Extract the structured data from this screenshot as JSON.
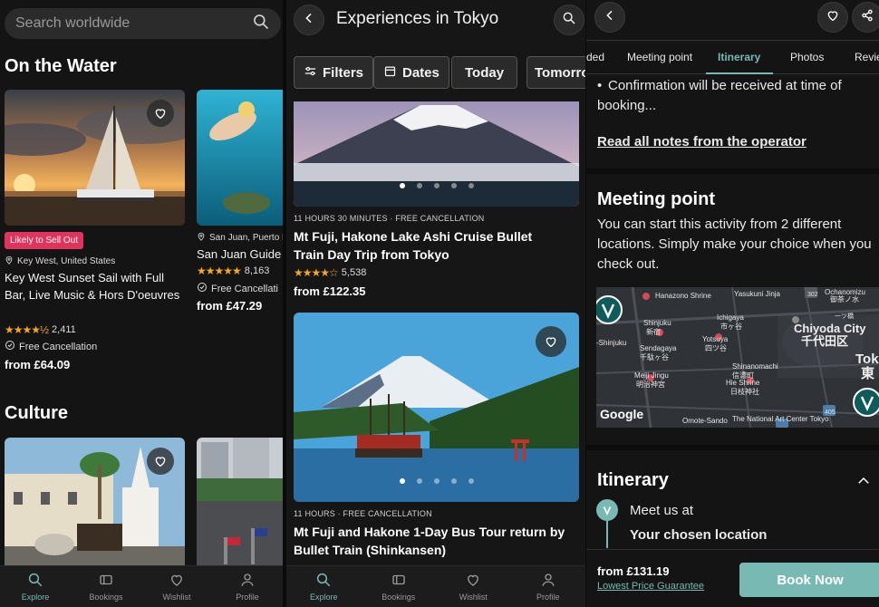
{
  "panel1": {
    "search_placeholder": "Search worldwide",
    "sections": [
      {
        "title": "On the Water",
        "cards": [
          {
            "badge": "Likely to Sell Out",
            "location": "Key West, United States",
            "title": "Key West Sunset Sail with Full Bar, Live Music & Hors D'oeuvres",
            "stars": "★★★★½",
            "rating": 4.5,
            "reviews": "2,411",
            "free": "Free Cancellation",
            "price": "from £64.09"
          },
          {
            "location": "San Juan, Puerto R",
            "title": "San Juan Guide",
            "stars": "★★★★★",
            "rating": 5,
            "reviews": "8,163",
            "free": "Free Cancellati",
            "price": "from £47.29"
          }
        ]
      },
      {
        "title": "Culture"
      }
    ]
  },
  "panel2": {
    "title": "Experiences in Tokyo",
    "chips": [
      "Filters",
      "Dates",
      "Today",
      "Tomorro"
    ],
    "cards": [
      {
        "meta": "11 HOURS 30 MINUTES · FREE CANCELLATION",
        "title": "Mt Fuji, Hakone Lake Ashi Cruise Bullet Train Day Trip from Tokyo",
        "stars": "★★★★☆",
        "rating": 4,
        "reviews": "5,538",
        "price": "from £122.35"
      },
      {
        "meta": "11 HOURS · FREE CANCELLATION",
        "title": "Mt Fuji and Hakone 1-Day Bus Tour return by Bullet Train (Shinkansen)"
      }
    ]
  },
  "panel3": {
    "tabs": [
      "ded",
      "Meeting point",
      "Itinerary",
      "Photos",
      "Revie"
    ],
    "bullet": "Confirmation will be received at time of booking...",
    "read_notes": "Read all notes from the operator",
    "meeting_title": "Meeting point",
    "meeting_text": "You can start this activity from 2 different locations. Simply make your choice when you check out.",
    "map_labels": [
      "Hanazono Shrine",
      "Yasukuni Jinja",
      "Ochanomizu",
      "御茶ノ水",
      "Shinjuku",
      "新宿",
      "Ichigaya",
      "市ヶ谷",
      "Chiyoda City",
      "千代田区",
      "Toky",
      "東",
      "-Shinjuku",
      "Sendagaya",
      "千駄ヶ谷",
      "Yotsuya",
      "四ツ谷",
      "Meiji Jingu",
      "明治神宮",
      "Shinanomachi",
      "信濃町",
      "Hie Shrine",
      "日枝神社",
      "Omote-Sando",
      "The National Art Center Tokyo",
      "Google",
      "302",
      "405",
      "一ツ橋"
    ],
    "itinerary_title": "Itinerary",
    "meet_us": "Meet us at",
    "chosen_location": "Your chosen location",
    "price": "from £131.19",
    "guarantee": "Lowest Price Guarantee",
    "book_label": "Book Now"
  },
  "tabbar": [
    "Explore",
    "Bookings",
    "Wishlist",
    "Profile"
  ],
  "colors": {
    "accent": "#79b9b3",
    "badge": "#e0345c",
    "star": "#f5a623",
    "background": "#141414"
  }
}
